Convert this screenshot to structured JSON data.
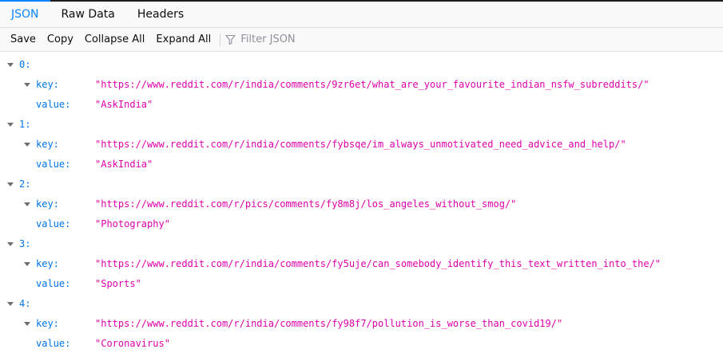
{
  "tabs": [
    {
      "label": "JSON"
    },
    {
      "label": "Raw Data"
    },
    {
      "label": "Headers"
    }
  ],
  "toolbar": {
    "save": "Save",
    "copy": "Copy",
    "collapse_all": "Collapse All",
    "expand_all": "Expand All",
    "filter_placeholder": "Filter JSON"
  },
  "entries": [
    {
      "index": "0:",
      "key_label": "key:",
      "key": "\"https://www.reddit.com/r/india/comments/9zr6et/what_are_your_favourite_indian_nsfw_subreddits/\"",
      "value_label": "value:",
      "value": "\"AskIndia\""
    },
    {
      "index": "1:",
      "key_label": "key:",
      "key": "\"https://www.reddit.com/r/india/comments/fybsqe/im_always_unmotivated_need_advice_and_help/\"",
      "value_label": "value:",
      "value": "\"AskIndia\""
    },
    {
      "index": "2:",
      "key_label": "key:",
      "key": "\"https://www.reddit.com/r/pics/comments/fy8m8j/los_angeles_without_smog/\"",
      "value_label": "value:",
      "value": "\"Photography\""
    },
    {
      "index": "3:",
      "key_label": "key:",
      "key": "\"https://www.reddit.com/r/india/comments/fy5uje/can_somebody_identify_this_text_written_into_the/\"",
      "value_label": "value:",
      "value": "\"Sports\""
    },
    {
      "index": "4:",
      "key_label": "key:",
      "key": "\"https://www.reddit.com/r/india/comments/fy98f7/pollution_is_worse_than_covid19/\"",
      "value_label": "value:",
      "value": "\"Coronavirus\""
    }
  ],
  "colors": {
    "accent": "#0a84ff",
    "index": "#0074e8",
    "string": "#dd00a9"
  }
}
